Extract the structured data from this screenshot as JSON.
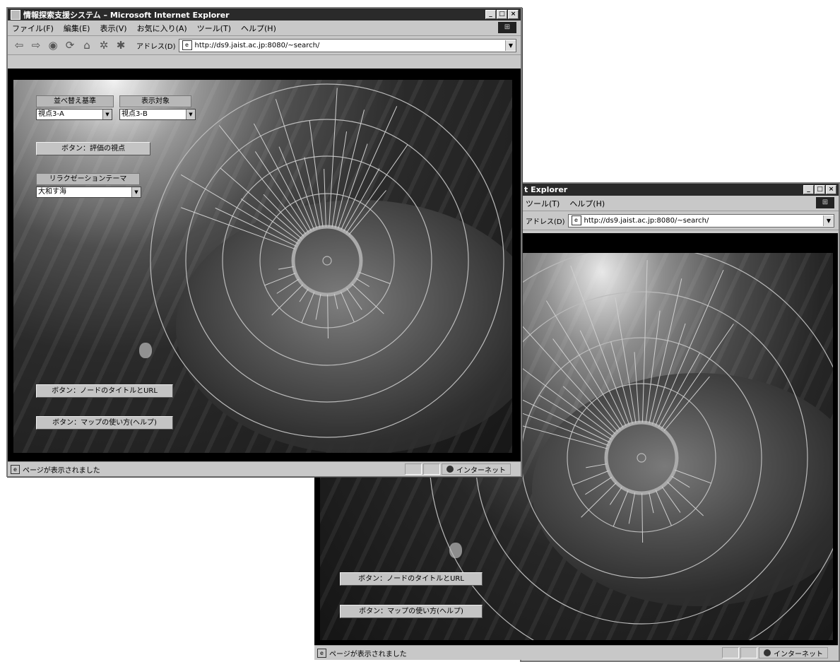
{
  "window1": {
    "title": "情報探索支援システム – Microsoft Internet Explorer",
    "buttons": {
      "minimize": "_",
      "maximize": "□",
      "close": "×"
    },
    "menu": [
      "ファイル(F)",
      "編集(E)",
      "表示(V)",
      "お気に入り(A)",
      "ツール(T)",
      "ヘルプ(H)"
    ],
    "address_label": "アドレス(D)",
    "address": "http://ds9.jaist.ac.jp:8080/~search/",
    "controls": {
      "sort_label": "並べ替え基準",
      "sort_value": "視点3-A",
      "display_label": "表示対象",
      "display_value": "視点3-B",
      "evaluate_button": "ボタン：評価の視点",
      "theme_label": "リラクゼーションテーマ",
      "theme_value": "大和す海",
      "node_button": "ボタン：ノードのタイトルとURL",
      "help_button": "ボタン：マップの使い方(ヘルプ)"
    },
    "status": "ページが表示されました",
    "zone": "インターネット"
  },
  "window2": {
    "title": "t Explorer",
    "buttons": {
      "minimize": "_",
      "maximize": "□",
      "close": "×"
    },
    "menu": [
      "ツール(T)",
      "ヘルプ(H)"
    ],
    "address_label": "アドレス(D)",
    "address": "http://ds9.jaist.ac.jp:8080/~search/",
    "controls": {
      "node_button": "ボタン：ノードのタイトルとURL",
      "help_button": "ボタン：マップの使い方(ヘルプ)"
    },
    "status": "ページが表示されました",
    "zone": "インターネット"
  },
  "icons": [
    "app-icon",
    "back-icon",
    "forward-icon",
    "stop-icon",
    "refresh-icon",
    "home-icon",
    "search-icon",
    "favorites-icon",
    "ie-page-icon",
    "globe-icon",
    "throbber-icon"
  ]
}
